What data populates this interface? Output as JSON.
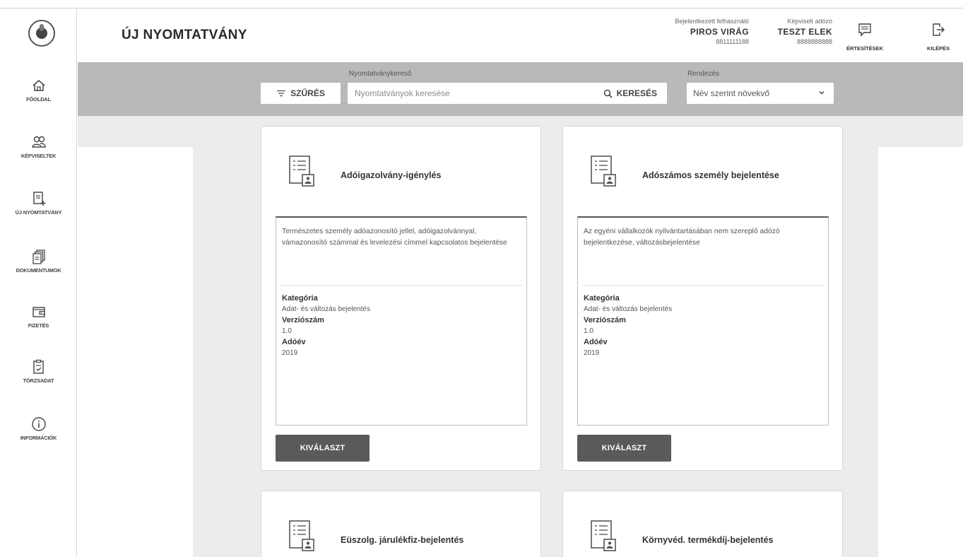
{
  "header": {
    "title": "ÚJ NYOMTATVÁNY",
    "logged_in_caption": "Bejelentkezett felhasználó",
    "logged_in_name": "PIROS VIRÁG",
    "logged_in_id": "8811111188",
    "represented_caption": "Képviselt adózó",
    "represented_name": "TESZT ELEK",
    "represented_id": "8888888888",
    "notifications_label": "ÉRTESÍTÉSEK",
    "logout_label": "KILÉPÉS"
  },
  "sidebar": {
    "items": [
      {
        "label": "FŐOLDAL",
        "icon": "home-icon"
      },
      {
        "label": "KÉPVISELTEK",
        "icon": "users-icon"
      },
      {
        "label": "ÚJ NYOMTATVÁNY",
        "icon": "new-form-icon"
      },
      {
        "label": "DOKUMENTUMOK",
        "icon": "documents-icon"
      },
      {
        "label": "FIZETÉS",
        "icon": "wallet-icon"
      },
      {
        "label": "TÖRZSADAT",
        "icon": "master-data-icon"
      },
      {
        "label": "INFORMÁCIÓK",
        "icon": "info-icon"
      }
    ]
  },
  "search": {
    "filter_label": "SZŰRÉS",
    "search_caption": "Nyomtatványkereső",
    "placeholder": "Nyomtatványok keresése",
    "search_button": "KERESÉS",
    "sort_caption": "Rendezés",
    "sort_value": "Név szerint növekvő"
  },
  "cards": [
    {
      "title": "Adóigazolvány-igénylés",
      "description": "Természetes személy adóazonosító jellel, adóigazolvánnyal, vámazonosító számmal és levelezési címmel kapcsolatos bejelentése",
      "category_label": "Kategória",
      "category": "Adat- és változás bejelentés",
      "version_label": "Verziószám",
      "version": "1.0",
      "year_label": "Adóév",
      "year": "2019",
      "button": "KIVÁLASZT"
    },
    {
      "title": "Adószámos személy bejelentése",
      "description": "Az egyéni vállalkozók nyilvántartásában nem szereplő adózó bejelentkezése, változásbejelentése",
      "category_label": "Kategória",
      "category": "Adat- és változás bejelentés",
      "version_label": "Verziószám",
      "version": "1.0",
      "year_label": "Adóév",
      "year": "2019",
      "button": "KIVÁLASZT"
    },
    {
      "title": "Eüszolg. járulékfiz-bejelentés"
    },
    {
      "title": "Környvéd. termékdíj-bejelentés"
    }
  ],
  "colors": {
    "search_band": "#b9b9b9",
    "main_background": "#ececec",
    "button": "#5a5a5a"
  }
}
